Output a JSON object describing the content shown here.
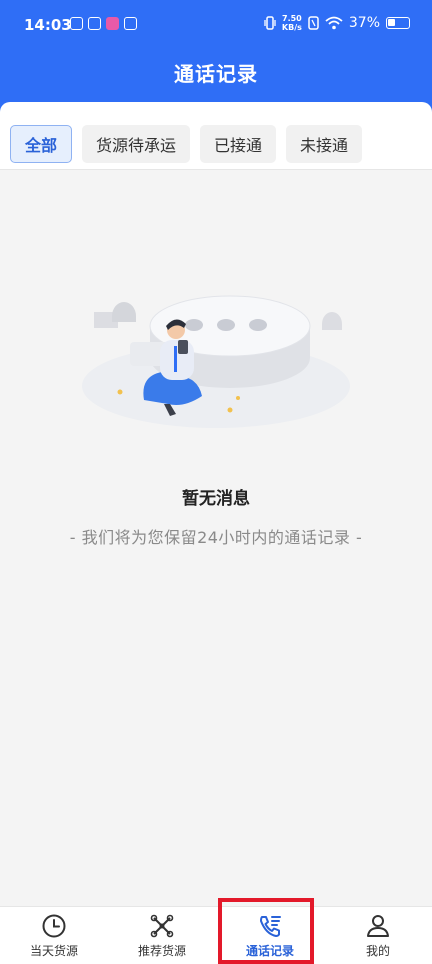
{
  "status_bar": {
    "time": "14:03",
    "net_speed_value": "7.50",
    "net_speed_unit": "KB/s",
    "battery": "37%"
  },
  "header": {
    "title": "通话记录"
  },
  "tabs": [
    {
      "label": "全部",
      "active": true
    },
    {
      "label": "货源待承运",
      "active": false
    },
    {
      "label": "已接通",
      "active": false
    },
    {
      "label": "未接通",
      "active": false
    }
  ],
  "empty_state": {
    "title": "暂无消息",
    "subtitle": "- 我们将为您保留24小时内的通话记录 -"
  },
  "bottom_nav": [
    {
      "label": "当天货源",
      "icon": "clock-icon",
      "active": false
    },
    {
      "label": "推荐货源",
      "icon": "recommend-icon",
      "active": false
    },
    {
      "label": "通话记录",
      "icon": "call-log-icon",
      "active": true
    },
    {
      "label": "我的",
      "icon": "user-icon",
      "active": false
    }
  ],
  "colors": {
    "brand": "#2f6ef6",
    "active_tab_text": "#2a62d8",
    "highlight_box": "#e3192a"
  }
}
